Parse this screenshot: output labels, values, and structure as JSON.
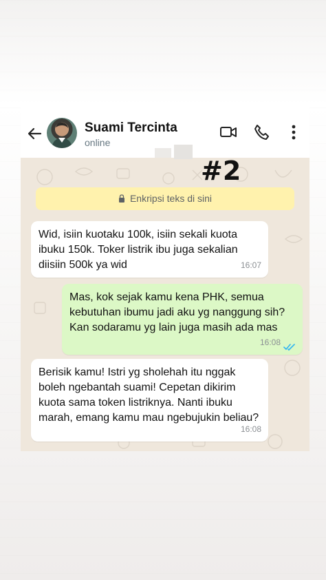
{
  "header": {
    "contact_name": "Suami Tercinta",
    "status": "online",
    "icons": [
      "back-arrow-icon",
      "video-call-icon",
      "phone-icon",
      "more-options-icon"
    ]
  },
  "notice": {
    "encryption_text": "Enkripsi teks di sini"
  },
  "overlay": {
    "tag": "#2"
  },
  "messages": [
    {
      "direction": "incoming",
      "text": "Wid, isiin kuotaku 100k, isiin sekali kuota ibuku 150k. Toker listrik ibu juga sekalian diisiin 500k ya wid",
      "time": "16:07"
    },
    {
      "direction": "outgoing",
      "text": "Mas, kok sejak kamu kena PHK, semua kebutuhan ibumu jadi aku yg nanggung sih? Kan sodaramu yg lain juga masih ada mas",
      "time": "16:08",
      "read_status": "read"
    },
    {
      "direction": "incoming",
      "text": "Berisik kamu! Istri yg sholehah itu nggak boleh ngebantah suami! Cepetan dikirim kuota sama token listriknya. Nanti ibuku marah, emang kamu mau ngebujukin beliau?",
      "time": "16:08"
    }
  ],
  "colors": {
    "incoming_bubble": "#ffffff",
    "outgoing_bubble": "#dcf8c6",
    "chat_background": "#efe7dc",
    "encryption_notice": "#fff2ad",
    "read_ticks": "#34b7f1"
  }
}
